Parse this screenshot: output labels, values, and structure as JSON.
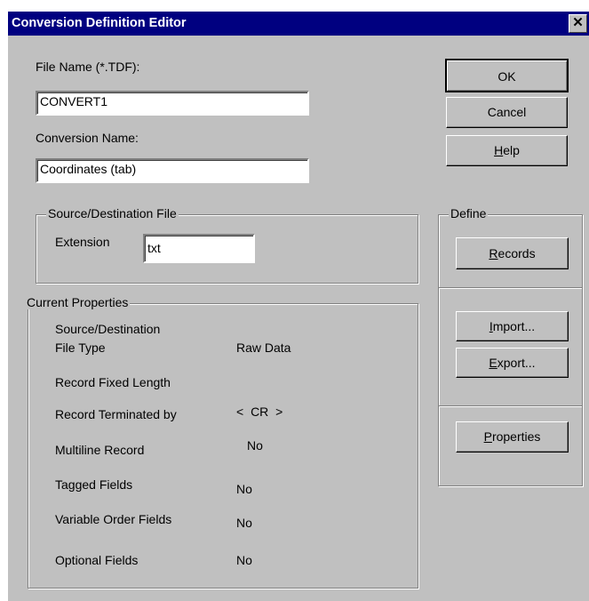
{
  "window": {
    "title": "Conversion Definition Editor",
    "close_glyph": "✕"
  },
  "form": {
    "file_name_label": "File Name (*.TDF):",
    "file_name_value": "CONVERT1",
    "conversion_name_label": "Conversion Name:",
    "conversion_name_value": "Coordinates (tab)"
  },
  "buttons": {
    "ok": "OK",
    "cancel": "Cancel",
    "help": "Help"
  },
  "source_dest": {
    "title": "Source/Destination File",
    "extension_label": "Extension",
    "extension_value": "txt"
  },
  "define": {
    "title": "Define",
    "records": "Records",
    "import": "Import...",
    "export": "Export...",
    "properties": "Properties"
  },
  "current_properties": {
    "title": "Current Properties",
    "file_type_label_1": "Source/Destination",
    "file_type_label_2": "File Type",
    "file_type_value": "Raw Data",
    "fixed_length_label": "Record Fixed Length",
    "terminated_label": "Record Terminated by",
    "terminated_value": "< CR >",
    "multiline_label": "Multiline Record",
    "multiline_value": "No",
    "tagged_label": "Tagged Fields",
    "tagged_value": "No",
    "variable_order_label": "Variable Order Fields",
    "variable_order_value": "No",
    "optional_label": "Optional Fields",
    "optional_value": "No"
  }
}
